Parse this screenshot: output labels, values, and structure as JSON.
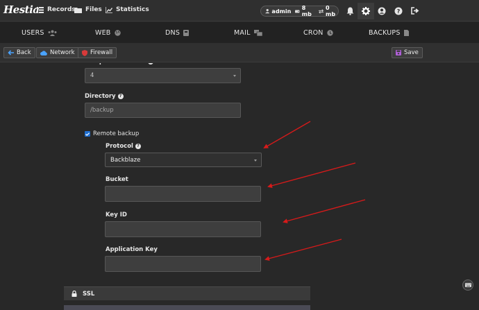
{
  "brand": {
    "logo_text": "Hestia"
  },
  "topnav": {
    "records": "Records",
    "files": "Files",
    "statistics": "Statistics"
  },
  "user": {
    "name": "admin",
    "disk": "8 mb",
    "bandwidth": "0 mb"
  },
  "tabs": [
    "USERS",
    "WEB",
    "DNS",
    "MAIL",
    "CRON",
    "BACKUPS"
  ],
  "toolbar": {
    "back": "Back",
    "network": "Network",
    "firewall": "Firewall",
    "save": "Save"
  },
  "form": {
    "compression_level": {
      "label": "Compression level",
      "value": "4"
    },
    "directory": {
      "label": "Directory",
      "placeholder": "/backup"
    },
    "remote_backup": {
      "label": "Remote backup",
      "checked": true
    },
    "protocol": {
      "label": "Protocol",
      "value": "Backblaze"
    },
    "bucket": {
      "label": "Bucket",
      "value": ""
    },
    "key_id": {
      "label": "Key ID",
      "value": ""
    },
    "application_key": {
      "label": "Application Key",
      "value": ""
    }
  },
  "sections": {
    "ssl": "SSL"
  },
  "colors": {
    "background": "#282828",
    "topbar": "#2f2f2f",
    "accent": "#1f6fd1",
    "annotation_arrow": "#d61a1a",
    "save_icon": "#b05fd8",
    "firewall_icon": "#d83a3a"
  }
}
